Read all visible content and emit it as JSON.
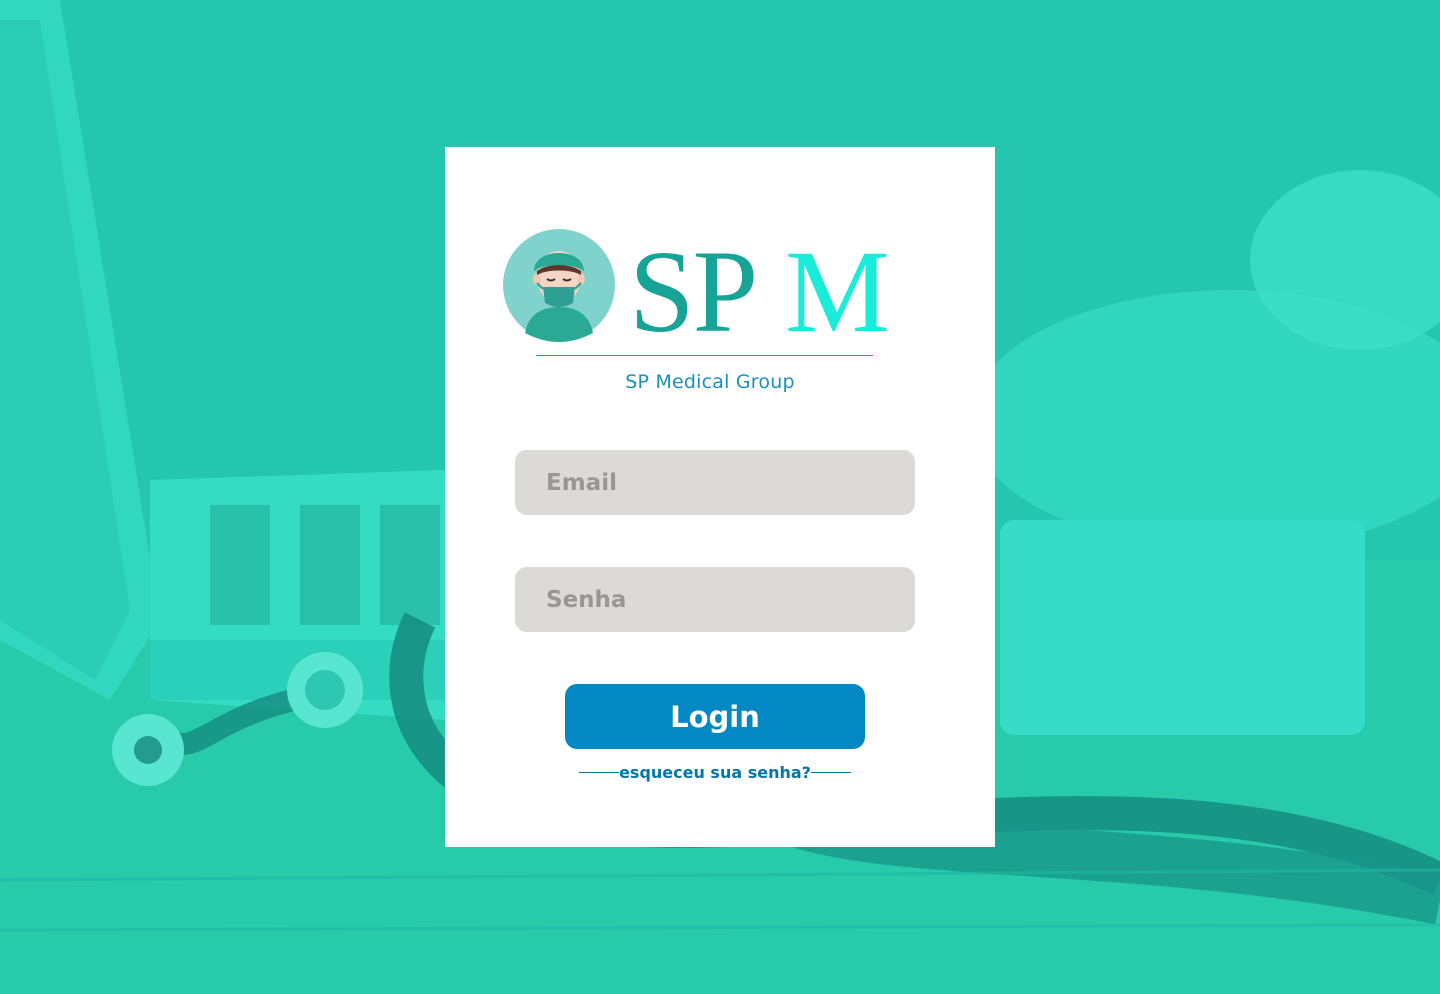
{
  "brand": {
    "logo_text": "SPM",
    "name": "SP Medical Group"
  },
  "form": {
    "email_placeholder": "Email",
    "email_value": "",
    "password_placeholder": "Senha",
    "password_value": "",
    "login_label": "Login",
    "forgot_label": "esqueceu sua senha?"
  },
  "colors": {
    "background": "#22c4ae",
    "card": "#ffffff",
    "primary_button": "#0488c4",
    "input_background": "#dcd9d9",
    "brand_text": "#1b8fbd",
    "logo_sp": "#17a497",
    "logo_m": "#19ecd8"
  }
}
